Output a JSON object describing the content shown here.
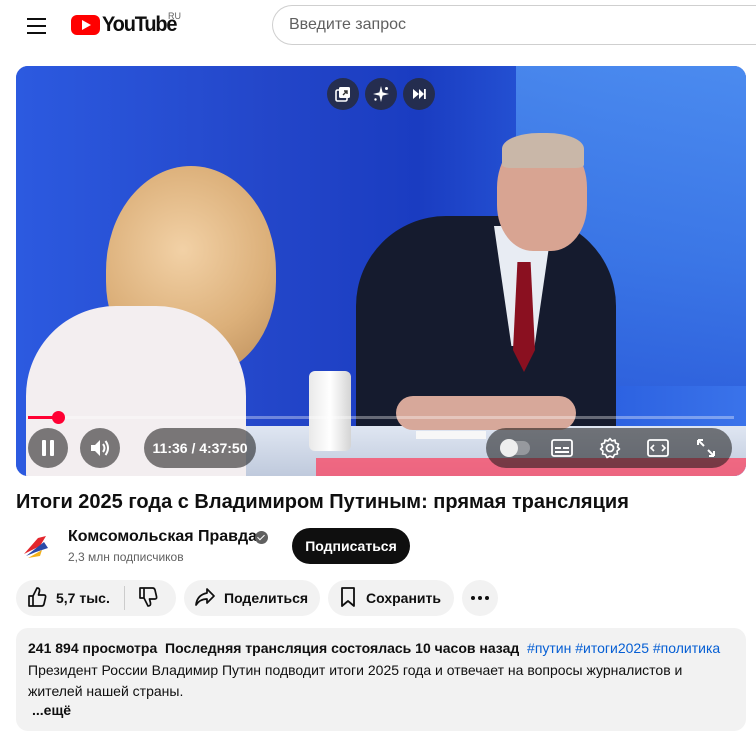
{
  "header": {
    "logo_text": "YouTube",
    "region": "RU",
    "search_placeholder": "Введите запрос"
  },
  "player": {
    "time_display": "11:36 / 4:37:50",
    "progress_fraction": 0.042,
    "overlay_icons": [
      "miniplayer-icon",
      "ai-sparkle-icon",
      "next-icon"
    ],
    "controls": [
      "pause-icon",
      "volume-icon",
      "autoplay-toggle",
      "subtitles-icon",
      "settings-icon",
      "theater-mode-icon",
      "fullscreen-icon"
    ],
    "accent_color": "#ff0033"
  },
  "video": {
    "title": "Итоги 2025 года с Владимиром Путиным: прямая трансляция"
  },
  "channel": {
    "name": "Комсомольская Правда",
    "subscribers": "2,3 млн подписчиков",
    "subscribe_label": "Подписаться",
    "verified": true
  },
  "actions": {
    "likes": "5,7 тыс.",
    "share_label": "Поделиться",
    "save_label": "Сохранить"
  },
  "description": {
    "views": "241 894 просмотра",
    "stream_info": "Последняя трансляция состоялась 10 часов назад",
    "tags": [
      "#путин",
      "#итоги2025",
      "#политика"
    ],
    "text": "Президент России Владимир Путин подводит итоги 2025 года и отвечает на вопросы журналистов и жителей нашей страны.",
    "more_label": "...ещё"
  }
}
